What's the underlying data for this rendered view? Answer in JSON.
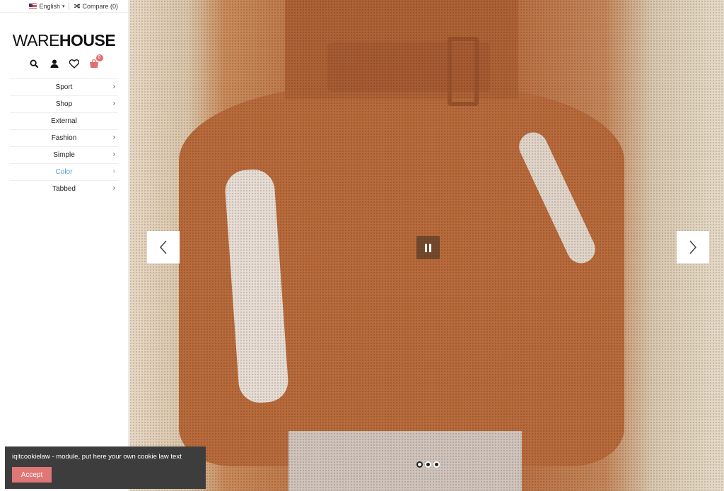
{
  "topbar": {
    "language": "English",
    "compare": "Compare (0)"
  },
  "logo": {
    "part1": "WARE",
    "part2": "HOUSE"
  },
  "header_icons": [
    "search-icon",
    "user-icon",
    "heart-icon",
    "cart-icon"
  ],
  "cart": {
    "count": "0"
  },
  "menu": [
    {
      "label": "Sport",
      "has_submenu": true
    },
    {
      "label": "Shop",
      "has_submenu": true
    },
    {
      "label": "External",
      "has_submenu": false
    },
    {
      "label": "Fashion",
      "has_submenu": true
    },
    {
      "label": "Simple",
      "has_submenu": true
    },
    {
      "label": "Color",
      "has_submenu": true,
      "active": true
    },
    {
      "label": "Tabbed",
      "has_submenu": true
    }
  ],
  "slider": {
    "slide_count": 3,
    "active_index": 0
  },
  "cookie": {
    "text": "iqitcookielaw - module, put here your own cookie law text",
    "accept": "Accept"
  },
  "colors": {
    "accent": "#5b9ed8",
    "cookie_bg": "#3d3d3d",
    "accept_btn": "#e07777",
    "badge": "#e06e6e"
  }
}
